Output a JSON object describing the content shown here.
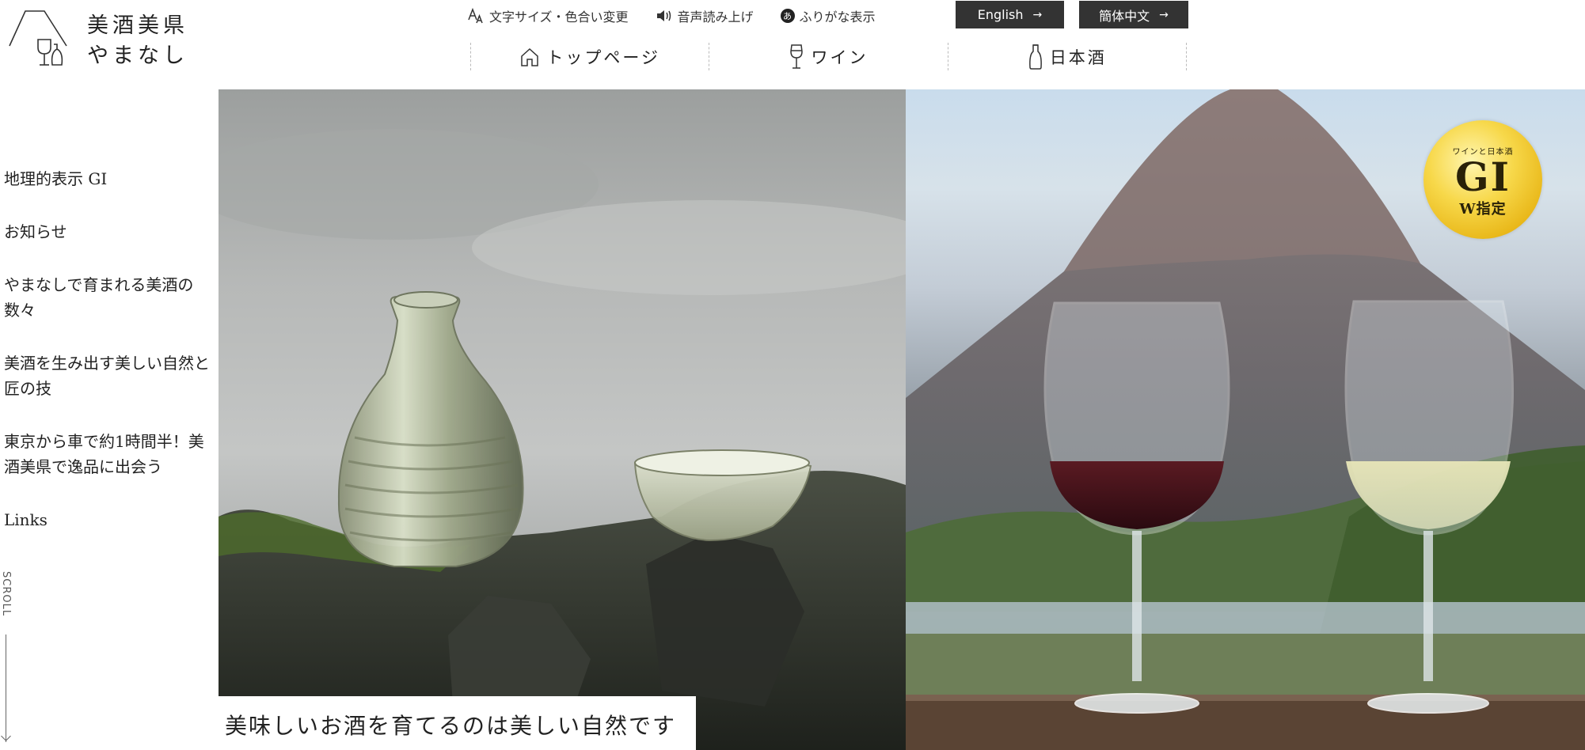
{
  "brand": {
    "name_line1": "美酒美県",
    "name_line2": "やまなし"
  },
  "utility": {
    "text_size": "文字サイズ・色合い変更",
    "read_aloud": "音声読み上げ",
    "furigana": "ふりがな表示",
    "furigana_icon_char": "あ"
  },
  "languages": [
    {
      "label": "English",
      "arrow": "→"
    },
    {
      "label": "簡体中文",
      "arrow": "→"
    }
  ],
  "global_nav": [
    {
      "label": "トップページ",
      "icon": "house-icon"
    },
    {
      "label": "ワイン",
      "icon": "wine-glass-icon"
    },
    {
      "label": "日本酒",
      "icon": "sake-bottle-icon"
    }
  ],
  "side_nav": [
    {
      "label": "地理的表示 GI"
    },
    {
      "label": "お知らせ"
    },
    {
      "label": "やまなしで育まれる美酒の数々"
    },
    {
      "label": "美酒を生み出す美しい自然と匠の技"
    },
    {
      "label": "東京から車で約1時間半！美酒美県で逸品に出会う"
    },
    {
      "label": "Links"
    }
  ],
  "scroll_label": "SCROLL",
  "hero": {
    "caption": "美味しいお酒を育てるのは美しい自然です",
    "badge": {
      "top": "ワインと日本酒",
      "main": "GI",
      "sub": "W指定"
    }
  },
  "colors": {
    "button_bg": "#333333",
    "badge_gold": "#f2c93a"
  }
}
